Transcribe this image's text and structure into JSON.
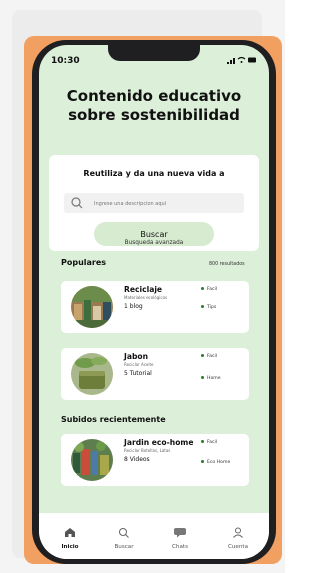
{
  "status": {
    "time": "10:30",
    "icons": "signal wifi battery"
  },
  "page": {
    "title_line1": "Contenido educativo",
    "title_line2": "sobre sostenibilidad"
  },
  "search": {
    "prompt": "Reutiliza y da una nueva vida a",
    "placeholder": "Ingrese una descripcion aqui",
    "button_label": "Buscar",
    "advanced_label": "Busqueda avanzada"
  },
  "popular": {
    "title": "Populares",
    "results": "800 resultados",
    "items": [
      {
        "title": "Reciclaje",
        "subtitle": "Materiales ecológicos",
        "count": "1",
        "unit": "blog",
        "tags": [
          "Facil",
          "Tips"
        ]
      },
      {
        "title": "Jabon",
        "subtitle": "Reciclar Aceite",
        "count": "5",
        "unit": "Tutorial",
        "tags": [
          "Facil",
          "Home"
        ]
      }
    ]
  },
  "recent": {
    "title": "Subidos recientemente",
    "items": [
      {
        "title": "Jardin eco-home",
        "subtitle": "Reciclar Botellas, Latas",
        "count": "8",
        "unit": "Videos",
        "tags": [
          "Facil",
          "Eco Home"
        ]
      }
    ]
  },
  "nav": [
    {
      "label": "Inicio",
      "icon": "home-icon"
    },
    {
      "label": "Buscar",
      "icon": "search-icon"
    },
    {
      "label": "Chats",
      "icon": "chat-icon"
    },
    {
      "label": "Cuenta",
      "icon": "user-icon"
    }
  ]
}
